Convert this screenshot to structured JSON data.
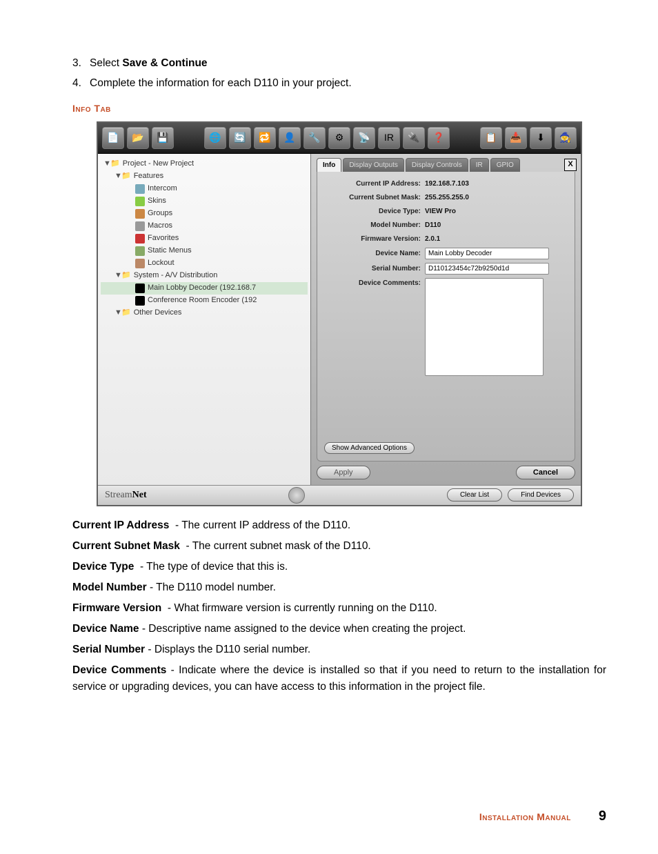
{
  "steps": [
    {
      "num": "3.",
      "prefix": "Select ",
      "bold": "Save & Continue",
      "suffix": ""
    },
    {
      "num": "4.",
      "prefix": "Complete the information for each D110 in your project.",
      "bold": "",
      "suffix": ""
    }
  ],
  "section_heading": "Info Tab",
  "tree": {
    "root": "Project - New Project",
    "features_label": "Features",
    "features": [
      "Intercom",
      "Skins",
      "Groups",
      "Macros",
      "Favorites",
      "Static Menus",
      "Lockout"
    ],
    "system_label": "System - A/V Distribution",
    "devices": [
      "Main Lobby Decoder (192.168.7",
      "Conference Room Encoder (192"
    ],
    "other_label": "Other Devices"
  },
  "tabs": [
    "Info",
    "Display Outputs",
    "Display Controls",
    "IR",
    "GPIO"
  ],
  "close": "X",
  "info": {
    "rows": [
      {
        "label": "Current IP Address:",
        "value": "192.168.7.103",
        "input": false
      },
      {
        "label": "Current Subnet Mask:",
        "value": "255.255.255.0",
        "input": false
      },
      {
        "label": "Device Type:",
        "value": "VIEW Pro",
        "input": false
      },
      {
        "label": "Model Number:",
        "value": "D110",
        "input": false
      },
      {
        "label": "Firmware Version:",
        "value": "2.0.1",
        "input": false
      },
      {
        "label": "Device Name:",
        "value": "Main Lobby Decoder",
        "input": true
      },
      {
        "label": "Serial Number:",
        "value": "D110123454c72b9250d1d",
        "input": true
      },
      {
        "label": "Device Comments:",
        "value": "",
        "textarea": true
      }
    ],
    "adv": "Show Advanced Options",
    "apply": "Apply",
    "cancel": "Cancel"
  },
  "footer_buttons": {
    "clear": "Clear List",
    "find": "Find Devices"
  },
  "brand": {
    "a": "Stream",
    "b": "Net"
  },
  "descriptions": [
    {
      "term": "Current IP Address",
      "spaced": true,
      "text": " - The current IP address of the D110."
    },
    {
      "term": "Current Subnet Mask",
      "spaced": true,
      "text": " - The current subnet mask of the D110."
    },
    {
      "term": "Device Type",
      "spaced": true,
      "text": " - The type of device that this is."
    },
    {
      "term": "Model Number",
      "spaced": false,
      "text": " - The D110 model number."
    },
    {
      "term": "Firmware Version",
      "spaced": true,
      "text": " - What firmware version is currently running on the D110."
    },
    {
      "term": "Device Name",
      "spaced": false,
      "text": " - Descriptive name assigned to the device when creating the project."
    },
    {
      "term": "Serial Number",
      "spaced": false,
      "text": " - Displays the D110 serial number."
    },
    {
      "term": "Device Comments",
      "spaced": false,
      "text": " - Indicate where the device is installed so that if you need to return to the installation for service or upgrading devices, you can have access to this information in the project file.",
      "justify": true
    }
  ],
  "page_footer": {
    "title": "Installation Manual",
    "num": "9"
  }
}
